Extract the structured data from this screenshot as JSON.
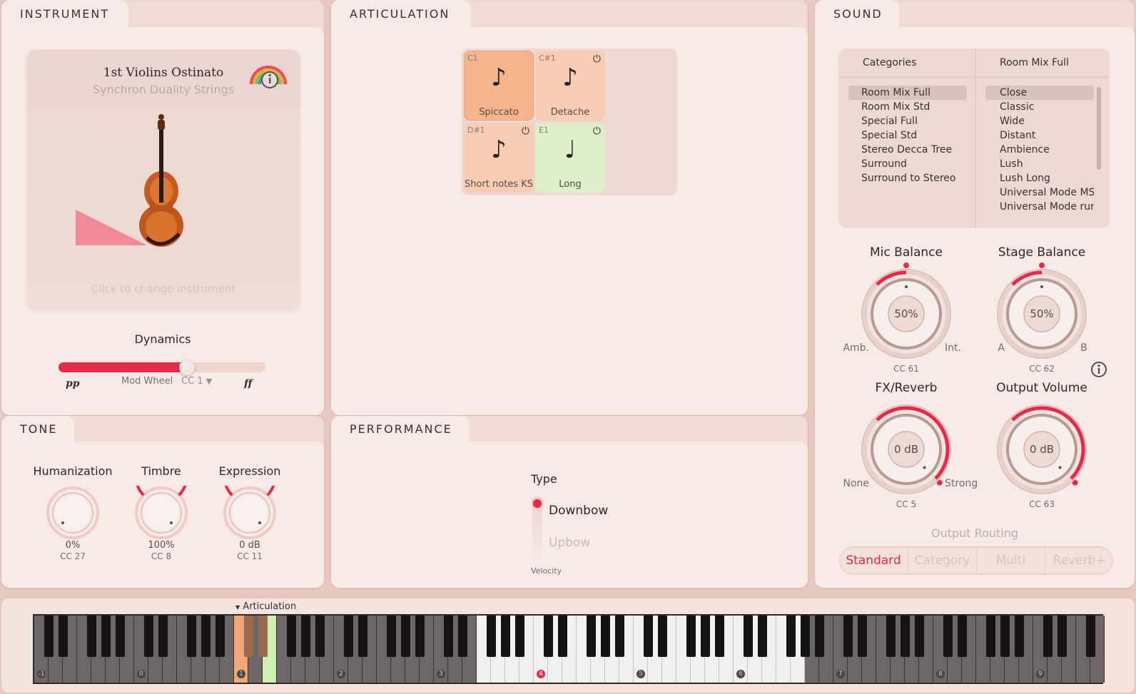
{
  "instrument": {
    "tab": "INSTRUMENT",
    "name": "1st Violins Ostinato",
    "library": "Synchron Duality Strings",
    "change_hint": "Click to change instrument",
    "dynamics_label": "Dynamics",
    "dyn_pp": "pp",
    "dyn_ff": "ff",
    "mod_wheel": "Mod Wheel",
    "cc": "CC 1",
    "dynamics_value": 0.62
  },
  "tone": {
    "tab": "TONE",
    "knobs": [
      {
        "label": "Humanization",
        "value": "0%",
        "cc": "CC 27"
      },
      {
        "label": "Timbre",
        "value": "100%",
        "cc": "CC 8"
      },
      {
        "label": "Expression",
        "value": "0 dB",
        "cc": "CC 11"
      }
    ]
  },
  "articulation": {
    "tab": "ARTICULATION",
    "cells": [
      {
        "key": "C1",
        "label": "Spiccato"
      },
      {
        "key": "C#1",
        "label": "Detache"
      },
      {
        "key": "D#1",
        "label": "Short notes KS"
      },
      {
        "key": "E1",
        "label": "Long"
      }
    ]
  },
  "performance": {
    "tab": "PERFORMANCE",
    "type_label": "Type",
    "options": [
      "Downbow",
      "Upbow"
    ],
    "velocity": "Velocity"
  },
  "sound": {
    "tab": "SOUND",
    "col1_head": "Categories",
    "col2_head": "Room Mix Full",
    "categories": [
      "Room Mix Full",
      "Room Mix Std",
      "Special Full",
      "Special Std",
      "Stereo Decca Tree",
      "Surround",
      "Surround to Stereo"
    ],
    "presets": [
      "Close",
      "Classic",
      "Wide",
      "Distant",
      "Ambience",
      "Lush",
      "Lush Long",
      "Universal Mode MST",
      "Universal Mode runt"
    ],
    "knobs": [
      {
        "label": "Mic Balance",
        "value": "50%",
        "cc": "CC 61",
        "left": "Amb.",
        "right": "Int."
      },
      {
        "label": "Stage Balance",
        "value": "50%",
        "cc": "CC 62",
        "left": "A",
        "right": "B"
      },
      {
        "label": "FX/Reverb",
        "value": "0 dB",
        "cc": "CC 5",
        "left": "None",
        "right": "Strong"
      },
      {
        "label": "Output Volume",
        "value": "0 dB",
        "cc": "CC 63",
        "left": "",
        "right": ""
      }
    ],
    "routing_label": "Output Routing",
    "routing": [
      "Standard",
      "Category",
      "Multi",
      "Reverb+"
    ]
  },
  "keyboard": {
    "label": "Articulation",
    "octaves": [
      "-1",
      "0",
      "1",
      "2",
      "3",
      "4",
      "5",
      "6",
      "7",
      "8",
      "9"
    ]
  },
  "colors": {
    "accent": "#e8294a",
    "art_active": "#f6b48c",
    "art_inactive": "#f8cdb3",
    "art_long": "#dcefc8"
  }
}
